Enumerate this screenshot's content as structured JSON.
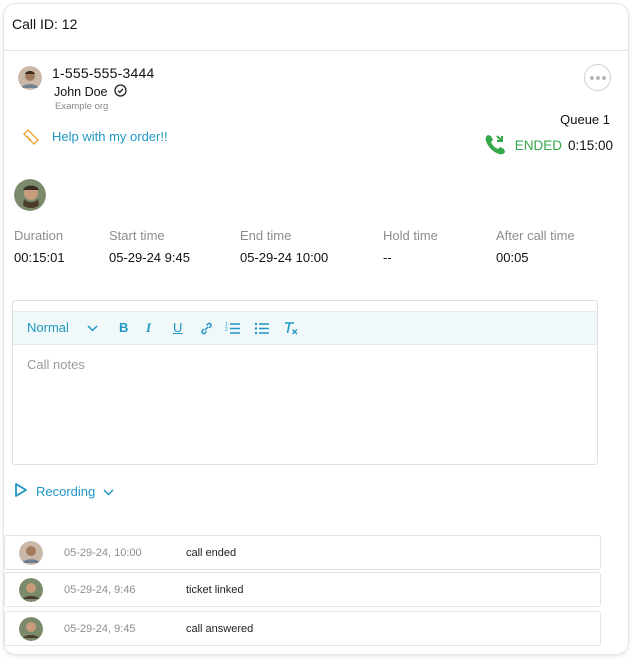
{
  "header": {
    "title": "Call ID: 12"
  },
  "caller": {
    "phone": "1-555-555-3444",
    "name": "John Doe",
    "org": "Example org"
  },
  "queue": "Queue 1",
  "ticket": {
    "label": "Help with my order!!"
  },
  "status": {
    "state": "ENDED",
    "duration": "0:15:00",
    "color": "#36a84a"
  },
  "stats": [
    {
      "label": "Duration",
      "value": "00:15:01"
    },
    {
      "label": "Start time",
      "value": "05-29-24 9:45"
    },
    {
      "label": "End time",
      "value": "05-29-24 10:00"
    },
    {
      "label": "Hold time",
      "value": "--"
    },
    {
      "label": "After call time",
      "value": "00:05"
    }
  ],
  "editor": {
    "format": "Normal",
    "placeholder": "Call notes",
    "toolbar": [
      "format-dropdown",
      "bold-icon",
      "italic-icon",
      "underline-icon",
      "link-icon",
      "ordered-list-icon",
      "bullet-list-icon",
      "clear-format-icon"
    ]
  },
  "recording": {
    "label": "Recording"
  },
  "activity": [
    {
      "date": "05-29-24, 10:00",
      "event": "call ended"
    },
    {
      "date": "05-29-24, 9:46",
      "event": "ticket linked"
    },
    {
      "date": "05-29-24, 9:45",
      "event": "call answered"
    }
  ],
  "colors": {
    "accent": "#1f97c4",
    "ticket_icon": "#e8a43a",
    "success": "#36a84a"
  }
}
